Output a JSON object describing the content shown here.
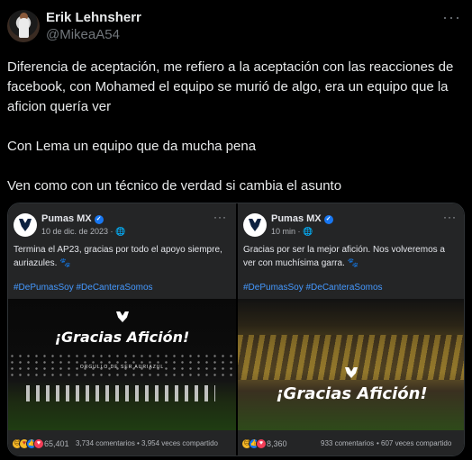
{
  "tweet": {
    "author_name": "Erik Lehnsherr",
    "author_handle": "@MikeaA54",
    "paragraphs": [
      "Diferencia de aceptación, me refiero a la aceptación con las reacciones de facebook, con Mohamed el equipo se murió de algo, era un equipo que la aficion quería ver",
      "Con Lema un equipo que da mucha pena",
      "Ven como con un técnico de verdad si cambia el asunto"
    ],
    "more_icon": "ellipsis-icon"
  },
  "posts": [
    {
      "page_name": "Pumas MX",
      "date": "10 de dic. de 2023 · ",
      "text": "Termina el AP23, gracias por todo el apoyo siempre, auriazules. 🐾",
      "hashtags": "#DePumasSoy #DeCanteraSomos",
      "banner": "¡Gracias Afición!",
      "sub_banner": "ORGULLO DE SER AURIAZUL",
      "reaction_count": "65,401",
      "comments": "3,734 comentarios",
      "shares": "3,954 veces compartido",
      "reactions": [
        "sad",
        "care",
        "like",
        "heart"
      ]
    },
    {
      "page_name": "Pumas MX",
      "date": "10 min · ",
      "text": "Gracias por ser la mejor afición. Nos volveremos a ver con muchísima garra. 🐾",
      "hashtags": "#DePumasSoy #DeCanteraSomos",
      "banner": "¡Gracias Afición!",
      "reaction_count": "8,360",
      "comments": "933 comentarios",
      "shares": "607 veces compartido",
      "reactions": [
        "sad",
        "like",
        "heart"
      ]
    }
  ],
  "colors": {
    "background": "#000000",
    "text": "#e7e9ea",
    "muted": "#71767b",
    "fb_card": "#242526",
    "hashtag": "#4599ff",
    "verified": "#1877f2"
  }
}
